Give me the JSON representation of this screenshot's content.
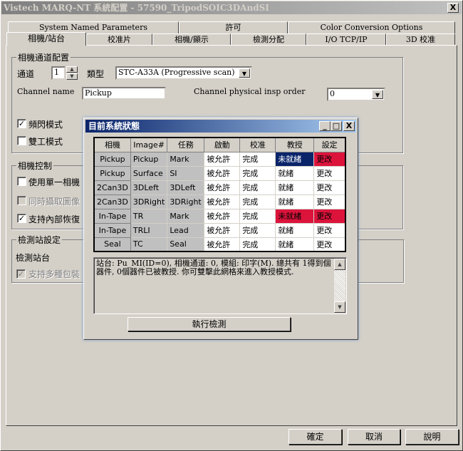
{
  "window": {
    "title": "Vistech MARQ-NT 系統配置 - 57590_TripodSOIC3DAndSI",
    "close": "X"
  },
  "tabs_row1": [
    "System Named Parameters",
    "許可",
    "Color Conversion Options"
  ],
  "tabs_row2": [
    "相機/站台",
    "校准片",
    "相機/顯示",
    "檢測分配",
    "I/O  TCP/IP",
    "3D 校准"
  ],
  "channel_group": {
    "title": "相機通道配置",
    "channel_label": "通道",
    "channel_value": "1",
    "type_label": "類型",
    "type_value": "STC-A33A (Progressive scan)",
    "name_label": "Channel name",
    "name_value": "Pickup",
    "order_label": "Channel physical insp order",
    "order_value": "0",
    "strobe_label": "頻閃模式",
    "strobe_checked": true,
    "duplex_label": "雙工模式",
    "duplex_checked": false
  },
  "camera_control": {
    "title": "相機控制",
    "single_label": "使用單一相機",
    "single_checked": false,
    "simul_label": "同時攝取圖像",
    "simul_checked": false,
    "recover_label": "支持內部恢復",
    "recover_checked": true
  },
  "station_group": {
    "title": "檢測站設定",
    "station_label": "檢測站台",
    "multi_label": "支持多種包裝",
    "multi_checked": true
  },
  "status_dialog": {
    "title": "目前系統狀態",
    "columns": [
      "相機",
      "Image#",
      "任務",
      "啟動",
      "校准",
      "教授",
      "設定"
    ],
    "rows": [
      [
        "Pickup",
        "Pickup",
        "Mark",
        "被允許",
        "完成",
        "未就緒",
        "更改"
      ],
      [
        "Pickup",
        "Surface",
        "SI",
        "被允許",
        "完成",
        "就緒",
        "更改"
      ],
      [
        "2Can3D",
        "3DLeft",
        "3DLeft",
        "被允許",
        "完成",
        "就緒",
        "更改"
      ],
      [
        "2Can3D",
        "3DRight",
        "3DRight",
        "被允許",
        "完成",
        "就緒",
        "更改"
      ],
      [
        "In-Tape",
        "TR",
        "Mark",
        "被允許",
        "完成",
        "未就緒",
        "更改"
      ],
      [
        "In-Tape",
        "TRLI",
        "Lead",
        "被允許",
        "完成",
        "就緒",
        "更改"
      ],
      [
        "Seal",
        "TC",
        "Seal",
        "被允許",
        "完成",
        "就緒",
        "更改"
      ]
    ],
    "message": "站台: Pu_MI(ID=0), 相機通道: 0, 模組: 印字(M). 總共有 1得到個器件, 0個器件已被教授. 你可雙擊此網格來進入教授模式.",
    "run_button": "執行檢測",
    "colors": {
      "selected": "#0a246a",
      "not_ready": "#dc143c"
    }
  },
  "buttons": {
    "ok": "確定",
    "cancel": "取消",
    "help": "說明"
  }
}
